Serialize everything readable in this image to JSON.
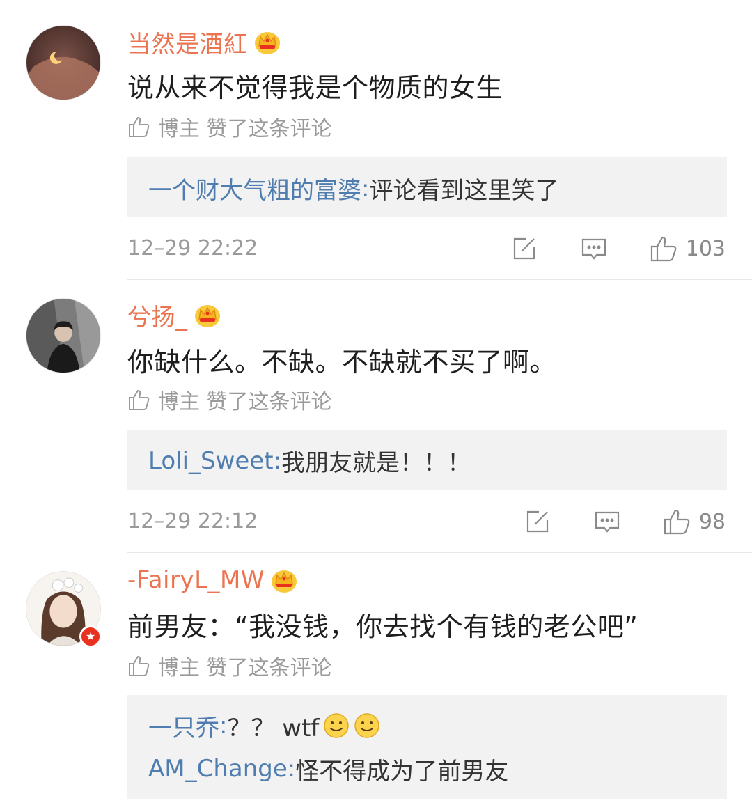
{
  "liked_by_author_label": "博主 赞了这条评论",
  "comments": [
    {
      "username": "当然是酒紅",
      "content": "说从来不觉得我是个物质的女生",
      "replies": [
        {
          "name": "一个财大气粗的富婆",
          "sep": ": ",
          "text": "评论看到这里笑了",
          "emoji_count": 0
        }
      ],
      "time": "12–29 22:22",
      "likes": "103"
    },
    {
      "username": "兮扬_",
      "content": "你缺什么。不缺。不缺就不买了啊。",
      "replies": [
        {
          "name": "Loli_Sweet",
          "sep": ": ",
          "text": "我朋友就是！！！",
          "emoji_count": 0
        }
      ],
      "time": "12–29 22:12",
      "likes": "98"
    },
    {
      "username": "-FairyL_MW",
      "content": "前男友：“我没钱，你去找个有钱的老公吧”",
      "replies": [
        {
          "name": "一只乔",
          "sep": ": ",
          "text": "？？ wtf",
          "emoji_count": 2
        },
        {
          "name": "AM_Change",
          "sep": ": ",
          "text": "怪不得成为了前男友",
          "emoji_count": 0
        }
      ]
    }
  ],
  "icons": {
    "crown": "crown-badge-icon",
    "thumb": "thumb-up-icon",
    "share": "share-edit-icon",
    "comment": "comment-icon",
    "verified": "verified-star-icon",
    "emoji": "smile-emoji-icon"
  },
  "colors": {
    "username": "#eb7350",
    "reply_name": "#507daf",
    "meta": "#9a9a9a",
    "reply_bg": "#f2f2f2",
    "verified": "#e8321f"
  }
}
